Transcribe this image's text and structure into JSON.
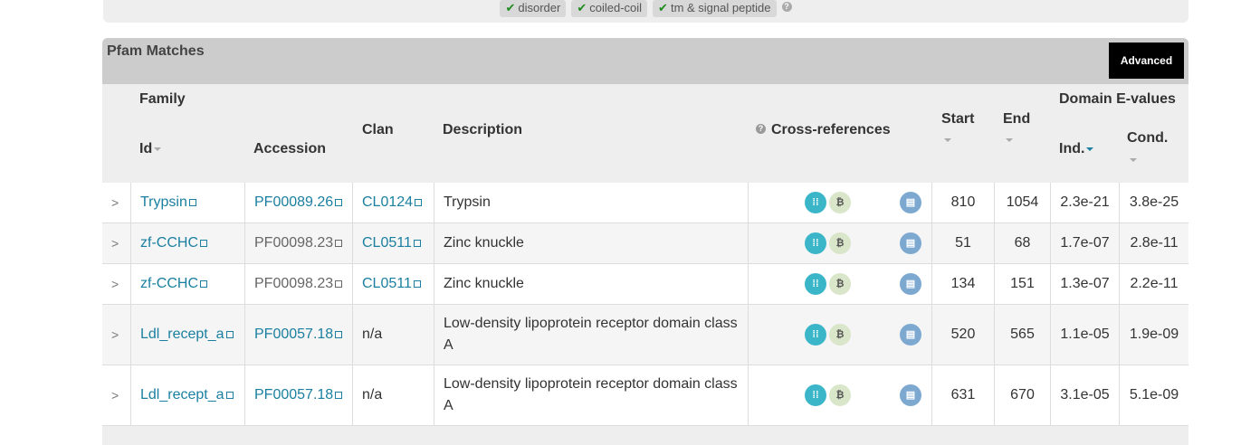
{
  "filters": [
    {
      "label": "disorder"
    },
    {
      "label": "coiled-coil"
    },
    {
      "label": "tm & signal peptide"
    }
  ],
  "panel": {
    "title": "Pfam Matches",
    "advanced_label": "Advanced"
  },
  "headers": {
    "family": "Family",
    "id": "Id",
    "accession": "Accession",
    "clan": "Clan",
    "description": "Description",
    "xrefs": "Cross-references",
    "start": "Start",
    "end": "End",
    "domain_evalues": "Domain E-values",
    "ind": "Ind.",
    "cond": "Cond."
  },
  "rows": [
    {
      "expand": ">",
      "id": "Trypsin",
      "accession": "PF00089.26",
      "clan": "CL0124",
      "description": "Trypsin",
      "start": "810",
      "end": "1054",
      "ind": "2.3e-21",
      "cond": "3.8e-25"
    },
    {
      "expand": ">",
      "id": "zf-CCHC",
      "accession": "PF00098.23",
      "clan": "CL0511",
      "description": "Zinc knuckle",
      "start": "51",
      "end": "68",
      "ind": "1.7e-07",
      "cond": "2.8e-11"
    },
    {
      "expand": ">",
      "id": "zf-CCHC",
      "accession": "PF00098.23",
      "clan": "CL0511",
      "description": "Zinc knuckle",
      "start": "134",
      "end": "151",
      "ind": "1.3e-07",
      "cond": "2.2e-11"
    },
    {
      "expand": ">",
      "id": "Ldl_recept_a",
      "accession": "PF00057.18",
      "clan": "n/a",
      "description": "Low-density lipoprotein receptor domain class A",
      "start": "520",
      "end": "565",
      "ind": "1.1e-05",
      "cond": "1.9e-09"
    },
    {
      "expand": ">",
      "id": "Ldl_recept_a",
      "accession": "PF00057.18",
      "clan": "n/a",
      "description": "Low-density lipoprotein receptor domain class A",
      "start": "631",
      "end": "670",
      "ind": "3.1e-05",
      "cond": "5.1e-09"
    }
  ],
  "icons": {
    "check": "check-icon",
    "help": "question-circle-icon",
    "external": "external-link-icon",
    "sort": "sort-caret-icon"
  }
}
